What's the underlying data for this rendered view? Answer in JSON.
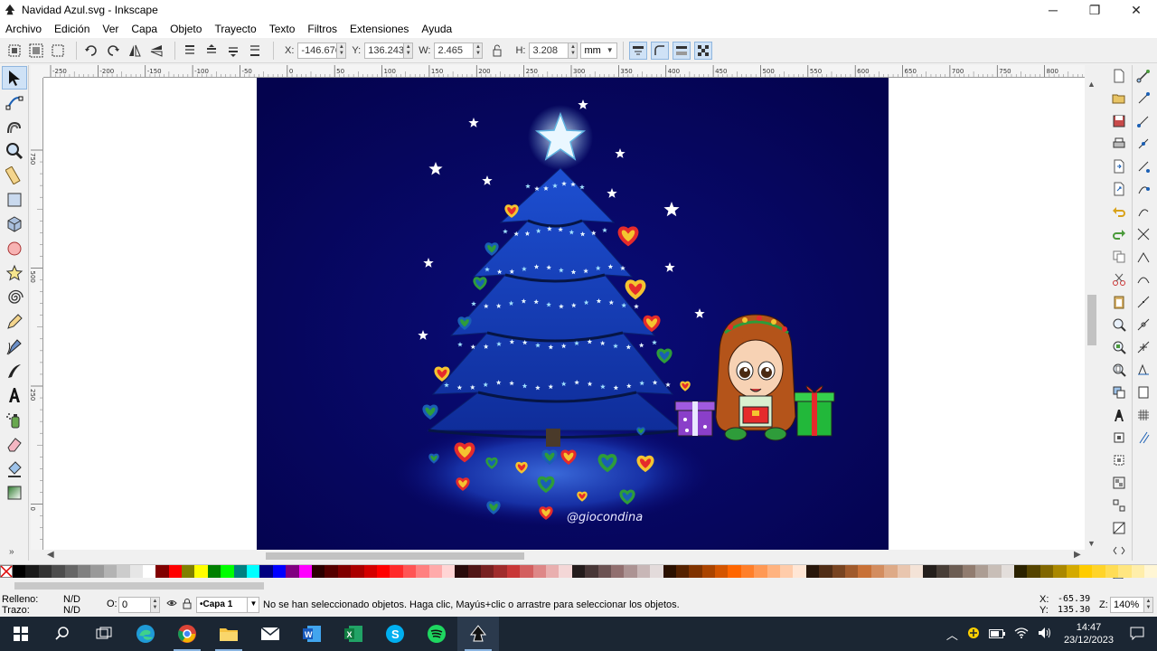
{
  "window": {
    "title": "Navidad Azul.svg - Inkscape",
    "controls": [
      "─",
      "❐",
      "✕"
    ]
  },
  "menu": [
    {
      "label": "Archivo"
    },
    {
      "label": "Edición"
    },
    {
      "label": "Ver"
    },
    {
      "label": "Capa"
    },
    {
      "label": "Objeto"
    },
    {
      "label": "Trayecto"
    },
    {
      "label": "Texto"
    },
    {
      "label": "Filtros"
    },
    {
      "label": "Extensiones"
    },
    {
      "label": "Ayuda"
    }
  ],
  "tool_controls": {
    "x_label": "X:",
    "x_value": "-146.676",
    "y_label": "Y:",
    "y_value": "136.243",
    "w_label": "W:",
    "w_value": "2.465",
    "h_label": "H:",
    "h_value": "3.208",
    "unit": "mm"
  },
  "rulers": {
    "top_labels": [
      "-250",
      "-200",
      "-150",
      "-100",
      "-50",
      "0",
      "50",
      "100",
      "150",
      "200",
      "250",
      "300",
      "350",
      "400",
      "450",
      "500",
      "550",
      "600",
      "650",
      "700",
      "750",
      "800"
    ],
    "left_labels": [
      "750",
      "500",
      "250",
      "0"
    ]
  },
  "toolbox": [
    "selector-icon",
    "node-icon",
    "tweak-icon",
    "zoom-icon",
    "measure-icon",
    "rectangle-icon",
    "box3d-icon",
    "ellipse-icon",
    "star-icon",
    "spiral-icon",
    "pencil-icon",
    "pen-icon",
    "calligraphy-icon",
    "text-icon",
    "spray-icon",
    "eraser-icon",
    "paint-bucket-icon",
    "gradient-icon"
  ],
  "artwork": {
    "watermark": "@giocondina",
    "background": "#05045a"
  },
  "palette": [
    "#000000",
    "#1a1a1a",
    "#333333",
    "#4d4d4d",
    "#666666",
    "#808080",
    "#999999",
    "#b3b3b3",
    "#cccccc",
    "#e6e6e6",
    "#ffffff",
    "#800000",
    "#ff0000",
    "#808000",
    "#ffff00",
    "#008000",
    "#00ff00",
    "#008080",
    "#00ffff",
    "#000080",
    "#0000ff",
    "#800080",
    "#ff00ff",
    "#2b0000",
    "#550000",
    "#800000",
    "#aa0000",
    "#d40000",
    "#ff0000",
    "#ff2a2a",
    "#ff5555",
    "#ff8080",
    "#ffaaaa",
    "#ffd5d5",
    "#280b0b",
    "#501616",
    "#782121",
    "#a02c2c",
    "#c83737",
    "#d35f5f",
    "#de8787",
    "#e9afaf",
    "#f4d7d7",
    "#241c1c",
    "#483737",
    "#6c5353",
    "#916f6f",
    "#ac9393",
    "#c8b7b7",
    "#e3dbdb",
    "#2b1100",
    "#552200",
    "#803300",
    "#aa4400",
    "#d45500",
    "#ff6600",
    "#ff7f2a",
    "#ff9955",
    "#ffb380",
    "#ffccaa",
    "#ffe6d5",
    "#28170b",
    "#502d16",
    "#784421",
    "#a05a2c",
    "#c87137",
    "#d38d5f",
    "#deaa87",
    "#e9c6af",
    "#f4e3d7",
    "#241f1c",
    "#483e37",
    "#6c5d53",
    "#917c6f",
    "#ac9d93",
    "#c8beb7",
    "#e3dedb",
    "#2b2200",
    "#554400",
    "#806600",
    "#aa8800",
    "#d4aa00",
    "#ffcc00",
    "#ffd42a",
    "#ffdd55",
    "#ffe680",
    "#ffeeaa",
    "#fff6d5"
  ],
  "statusbar": {
    "fill_label": "Relleno:",
    "fill_value": "N/D",
    "stroke_label": "Trazo:",
    "stroke_value": "N/D",
    "opacity_label": "O:",
    "opacity_value": "0",
    "layer": "•Capa 1",
    "message": "No se han seleccionado objetos. Haga clic, Mayús+clic o arrastre para seleccionar los objetos.",
    "x_label": "X:",
    "x_value": "-65.39",
    "y_label": "Y:",
    "y_value": "135.30",
    "zoom_label": "Z:",
    "zoom_value": "140%"
  },
  "taskbar": {
    "apps": [
      "windows-start-icon",
      "search-icon",
      "task-view-icon",
      "edge-icon",
      "chrome-icon",
      "file-explorer-icon",
      "mail-icon",
      "word-icon",
      "excel-icon",
      "skype-icon",
      "spotify-icon",
      "inkscape-icon"
    ],
    "time": "14:47",
    "date": "23/12/2023"
  }
}
